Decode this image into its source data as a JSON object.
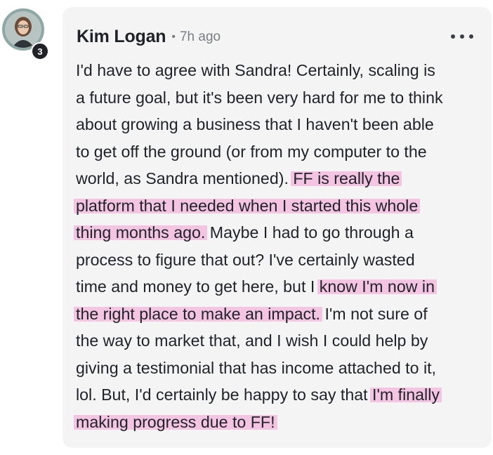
{
  "post": {
    "author_name": "Kim Logan",
    "separator": "•",
    "timestamp": "7h ago",
    "level": "3",
    "more_icon": "more-horizontal-icon"
  },
  "comment": {
    "lines": [
      [
        {
          "text": "I'd have to agree with Sandra! Certainly, scaling is",
          "hl": false
        }
      ],
      [
        {
          "text": "a future goal, but it's been very hard for me to think",
          "hl": false
        }
      ],
      [
        {
          "text": "about growing a business that I haven't been able",
          "hl": false
        }
      ],
      [
        {
          "text": "to get off the ground (or from my computer to the",
          "hl": false
        }
      ],
      [
        {
          "text": "world, as Sandra mentioned). ",
          "hl": false
        },
        {
          "text": "FF is really the",
          "hl": true
        }
      ],
      [
        {
          "text": "platform that I needed when I started this whole",
          "hl": true
        }
      ],
      [
        {
          "text": "thing months ago.",
          "hl": true
        },
        {
          "text": " Maybe I had to go through a",
          "hl": false
        }
      ],
      [
        {
          "text": "process to figure that out? I've certainly wasted",
          "hl": false
        }
      ],
      [
        {
          "text": "time and money to get here, but I ",
          "hl": false
        },
        {
          "text": "know I'm now in",
          "hl": true
        }
      ],
      [
        {
          "text": "the right place to make an impact.",
          "hl": true
        },
        {
          "text": " I'm not sure of",
          "hl": false
        }
      ],
      [
        {
          "text": "the way to market that, and I wish I could help by",
          "hl": false
        }
      ],
      [
        {
          "text": "giving a testimonial that has income attached to it,",
          "hl": false
        }
      ],
      [
        {
          "text": "lol. But, I'd certainly be happy to say that ",
          "hl": false
        },
        {
          "text": "I'm finally",
          "hl": true
        }
      ],
      [
        {
          "text": "making progress due to FF!",
          "hl": true
        }
      ]
    ],
    "highlight_color": "#f4b6de"
  }
}
